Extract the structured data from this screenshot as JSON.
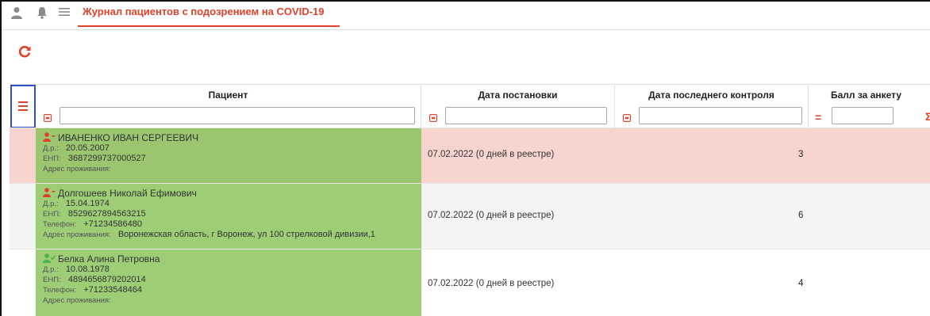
{
  "header": {
    "user_icon": "user-icon",
    "bell_icon": "bell-icon",
    "menu_icon": "menu-icon",
    "title": "Журнал пациентов с подозрением на COVID-19"
  },
  "toolbar": {
    "refresh_icon": "refresh-icon"
  },
  "columns": [
    {
      "title": "Пациент"
    },
    {
      "title": "Дата постановки"
    },
    {
      "title": "Дата последнего контроля"
    },
    {
      "title": "Балл за анкету"
    }
  ],
  "filters": {
    "score_operator": "=",
    "score_sigma": "Σ"
  },
  "labels": {
    "dob": "Д.р.:",
    "enp": "ЕНП:",
    "phone": "Телефон:",
    "address": "Адрес проживания:"
  },
  "colors": {
    "accent": "#e0412b",
    "highlight_border": "#2d52c9",
    "row_alert": "#f8d4cf",
    "row_alt": "#f4f4f4",
    "patient_green": "#9dce76",
    "patient_green_dark": "#9bc56e",
    "user_red": "#e0412b",
    "user_green": "#4caf50"
  },
  "rows": [
    {
      "status_icon": "user-alert-icon",
      "name": "ИВАНЕНКО ИВАН СЕРГЕЕВИЧ",
      "dob": "20.05.2007",
      "enp": "3687299737000527",
      "phone": "",
      "address": "",
      "date_added": "07.02.2022 (0 дней в реестре)",
      "last_control": "",
      "score": "3"
    },
    {
      "status_icon": "user-alert-icon",
      "name": "Долгошеев Николай Ефимович",
      "dob": "15.04.1974",
      "enp": "8529627894563215",
      "phone": "+71234586480",
      "address": "Воронежская область, г Воронеж, ул 100 стрелковой дивизии,1",
      "date_added": "07.02.2022 (0 дней в реестре)",
      "last_control": "",
      "score": "6"
    },
    {
      "status_icon": "user-check-icon",
      "name": "Белка Алина Петровна",
      "dob": "10.08.1978",
      "enp": "4894656879202014",
      "phone": "+71233548464",
      "address": "",
      "date_added": "07.02.2022 (0 дней в реестре)",
      "last_control": "",
      "score": "4"
    }
  ]
}
